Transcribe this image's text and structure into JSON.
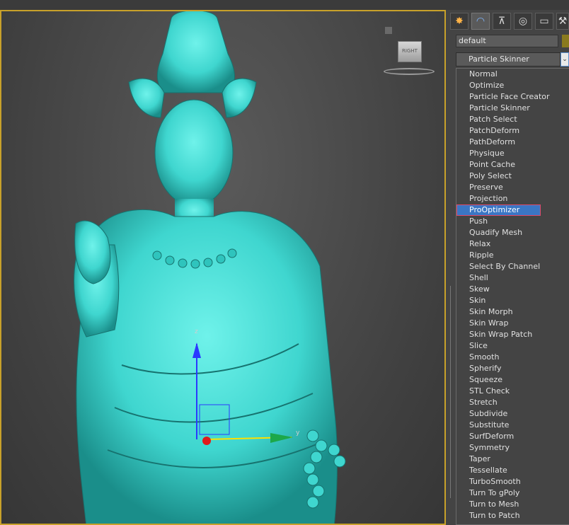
{
  "viewport": {
    "viewcube_label": "RIGHT",
    "axis_labels": {
      "z": "z",
      "y": "y"
    }
  },
  "command_panel": {
    "tabs": [
      {
        "icon": "create-icon"
      },
      {
        "icon": "modify-icon",
        "active": true
      },
      {
        "icon": "hierarchy-icon"
      },
      {
        "icon": "motion-icon"
      },
      {
        "icon": "display-icon"
      },
      {
        "icon": "utilities-icon"
      }
    ],
    "object_name": "default",
    "modifier_list_value": "Particle Skinner",
    "modifier_options": [
      "Normal",
      "Optimize",
      "Particle Face Creator",
      "Particle Skinner",
      "Patch Select",
      "PatchDeform",
      "PathDeform",
      "Physique",
      "Point Cache",
      "Poly Select",
      "Preserve",
      "Projection",
      "ProOptimizer",
      "Push",
      "Quadify Mesh",
      "Relax",
      "Ripple",
      "Select By Channel",
      "Shell",
      "Skew",
      "Skin",
      "Skin Morph",
      "Skin Wrap",
      "Skin Wrap Patch",
      "Slice",
      "Smooth",
      "Spherify",
      "Squeeze",
      "STL Check",
      "Stretch",
      "Subdivide",
      "Substitute",
      "SurfDeform",
      "Symmetry",
      "Taper",
      "Tessellate",
      "TurboSmooth",
      "Turn To gPoly",
      "Turn to Mesh",
      "Turn to Patch"
    ],
    "highlighted_option": "ProOptimizer",
    "colors": {
      "selection": "#3a76c4",
      "viewport_border": "#c8a12a",
      "model": "#3fd6cf"
    }
  }
}
